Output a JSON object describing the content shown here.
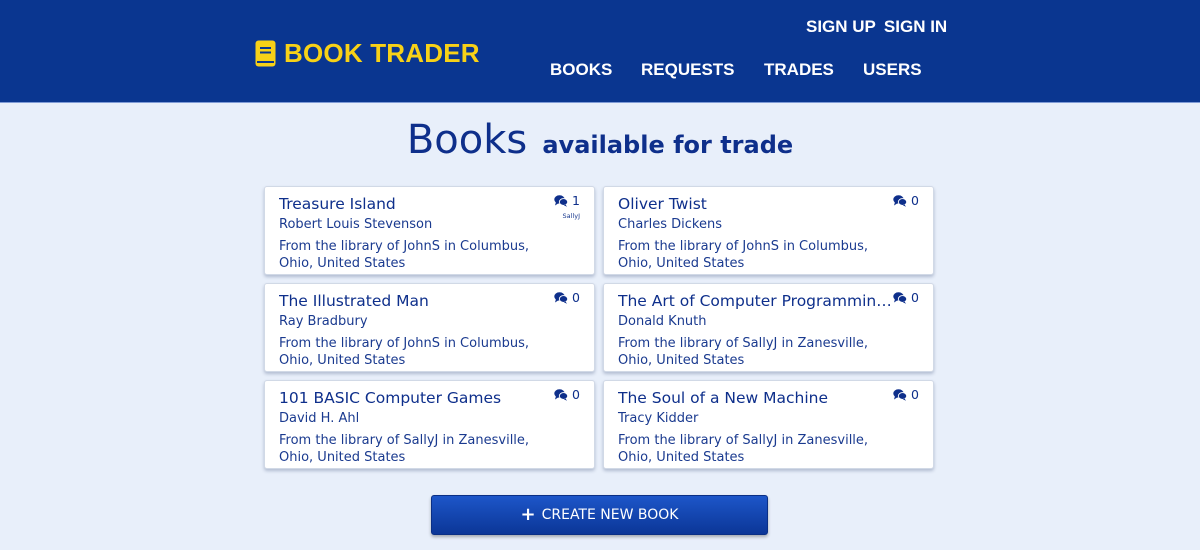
{
  "header": {
    "brand": "BOOK TRADER",
    "auth": {
      "sign_up": "SIGN UP",
      "sign_in": "SIGN IN"
    },
    "nav": {
      "books": "BOOKS",
      "requests": "REQUESTS",
      "trades": "TRADES",
      "users": "USERS"
    }
  },
  "page": {
    "title_main": "Books",
    "title_sub": "available for trade"
  },
  "books": [
    {
      "title": "Treasure Island",
      "author": "Robert Louis Stevenson",
      "library": "From the library of JohnS in Columbus, Ohio, United States",
      "requests": "1",
      "requester": "SallyJ"
    },
    {
      "title": "Oliver Twist",
      "author": "Charles Dickens",
      "library": "From the library of JohnS in Columbus, Ohio, United States",
      "requests": "0",
      "requester": ""
    },
    {
      "title": "The Illustrated Man",
      "author": "Ray Bradbury",
      "library": "From the library of JohnS in Columbus, Ohio, United States",
      "requests": "0",
      "requester": ""
    },
    {
      "title": "The Art of Computer Programming,...",
      "author": "Donald Knuth",
      "library": "From the library of SallyJ in Zanesville, Ohio, United States",
      "requests": "0",
      "requester": ""
    },
    {
      "title": "101 BASIC Computer Games",
      "author": "David H. Ahl",
      "library": "From the library of SallyJ in Zanesville, Ohio, United States",
      "requests": "0",
      "requester": ""
    },
    {
      "title": "The Soul of a New Machine",
      "author": "Tracy Kidder",
      "library": "From the library of SallyJ in Zanesville, Ohio, United States",
      "requests": "0",
      "requester": ""
    }
  ],
  "actions": {
    "create_label": "CREATE NEW BOOK"
  },
  "colors": {
    "header_bg": "#0a3690",
    "brand": "#f7d117",
    "page_bg": "#e8effa",
    "text": "#0e2f8b"
  },
  "icons": {
    "brand": "book-icon",
    "requests": "comments-icon",
    "create": "plus-icon"
  }
}
